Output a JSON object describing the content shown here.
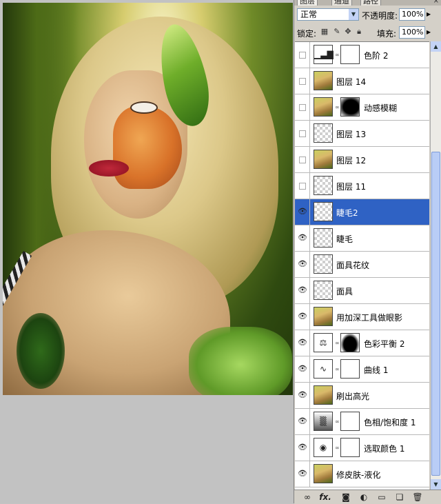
{
  "panel": {
    "tabs": [
      {
        "label": "图层"
      },
      {
        "label": "通道"
      },
      {
        "label": "路径"
      }
    ],
    "close_glyph": "×",
    "blend_mode": "正常",
    "opacity_label": "不透明度:",
    "opacity_value": "100%",
    "lock_label": "锁定:",
    "fill_label": "填充:",
    "fill_value": "100%"
  },
  "layers": [
    {
      "name": "色阶 2",
      "visible": false,
      "thumb": "levels-icon",
      "has_mask": true,
      "mask": "white",
      "selected": false
    },
    {
      "name": "图层 14",
      "visible": false,
      "thumb": "photo",
      "has_mask": false,
      "selected": false
    },
    {
      "name": "动感模糊",
      "visible": false,
      "thumb": "photo",
      "has_mask": true,
      "mask": "blur-mask",
      "selected": false
    },
    {
      "name": "图层 13",
      "visible": false,
      "thumb": "transparent",
      "has_mask": false,
      "selected": false
    },
    {
      "name": "图层 12",
      "visible": false,
      "thumb": "photo",
      "has_mask": false,
      "selected": false
    },
    {
      "name": "图层 11",
      "visible": false,
      "thumb": "transparent",
      "has_mask": false,
      "selected": false
    },
    {
      "name": "睫毛2",
      "visible": true,
      "thumb": "transparent",
      "has_mask": false,
      "selected": true
    },
    {
      "name": "睫毛",
      "visible": true,
      "thumb": "transparent",
      "has_mask": false,
      "selected": false
    },
    {
      "name": "面具花纹",
      "visible": true,
      "thumb": "transparent",
      "has_mask": false,
      "selected": false
    },
    {
      "name": "面具",
      "visible": true,
      "thumb": "transparent",
      "has_mask": false,
      "selected": false
    },
    {
      "name": "用加深工具做眼影",
      "visible": true,
      "thumb": "photo",
      "has_mask": false,
      "selected": false
    },
    {
      "name": "色彩平衡 2",
      "visible": true,
      "thumb": "color-balance-icon",
      "has_mask": true,
      "mask": "cb-mask",
      "selected": false
    },
    {
      "name": "曲线 1",
      "visible": true,
      "thumb": "curves-icon",
      "has_mask": true,
      "mask": "white",
      "selected": false
    },
    {
      "name": "刷出高光",
      "visible": true,
      "thumb": "photo",
      "has_mask": false,
      "selected": false
    },
    {
      "name": "色相/饱和度 1",
      "visible": true,
      "thumb": "hue-saturation-icon",
      "has_mask": true,
      "mask": "white",
      "selected": false
    },
    {
      "name": "选取颜色 1",
      "visible": true,
      "thumb": "selective-color-icon",
      "has_mask": true,
      "mask": "sel-mask",
      "selected": false
    },
    {
      "name": "修皮肤-液化",
      "visible": true,
      "thumb": "photo",
      "has_mask": false,
      "selected": false
    }
  ],
  "bottom_bar": {
    "icons": [
      "link-layers-icon",
      "fx-icon",
      "add-mask-icon",
      "adjustment-layer-icon",
      "new-group-icon",
      "new-layer-icon",
      "trash-icon"
    ],
    "fx_label": "fx."
  },
  "colors": {
    "selection": "#2f62c4",
    "panel_bg": "#d4d0c8"
  }
}
